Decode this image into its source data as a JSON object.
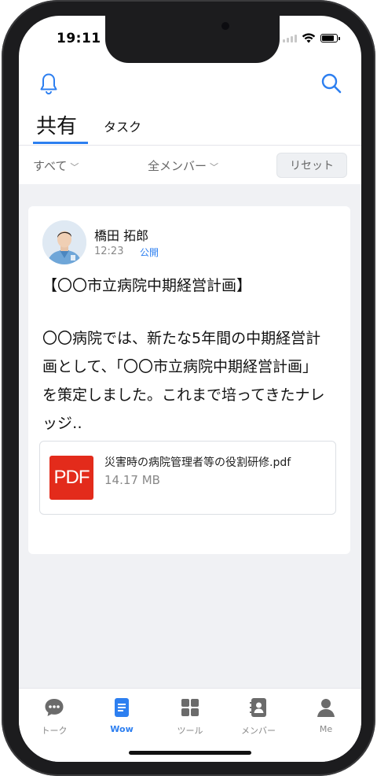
{
  "status_bar": {
    "time": "19:11"
  },
  "tabs": [
    {
      "label": "共有",
      "active": true
    },
    {
      "label": "タスク",
      "active": false
    }
  ],
  "filters": {
    "scope": "すべて",
    "members": "全メンバー",
    "reset_label": "リセット"
  },
  "post": {
    "author": "橋田 拓郎",
    "time": "12:23",
    "visibility": "公開",
    "title": "【〇〇市立病院中期経営計画】",
    "body": "〇〇病院では、新たな5年間の中期経営計画として、「〇〇市立病院中期経営計画」を策定しました。これまで培ってきたナレッジ‥",
    "attachment": {
      "type_label": "PDF",
      "file_name": "災害時の病院管理者等の役割研修.pdf",
      "file_size": "14.17 MB"
    }
  },
  "bottom_nav": [
    {
      "label": "トーク",
      "icon": "chat-bubble-icon",
      "active": false
    },
    {
      "label": "Wow",
      "icon": "document-icon",
      "active": true
    },
    {
      "label": "ツール",
      "icon": "grid-icon",
      "active": false
    },
    {
      "label": "メンバー",
      "icon": "contacts-icon",
      "active": false
    },
    {
      "label": "Me",
      "icon": "person-icon",
      "active": false
    }
  ],
  "colors": {
    "accent": "#2d7ff0",
    "pdf_red": "#e32b1b",
    "feed_bg": "#f0f1f4"
  }
}
